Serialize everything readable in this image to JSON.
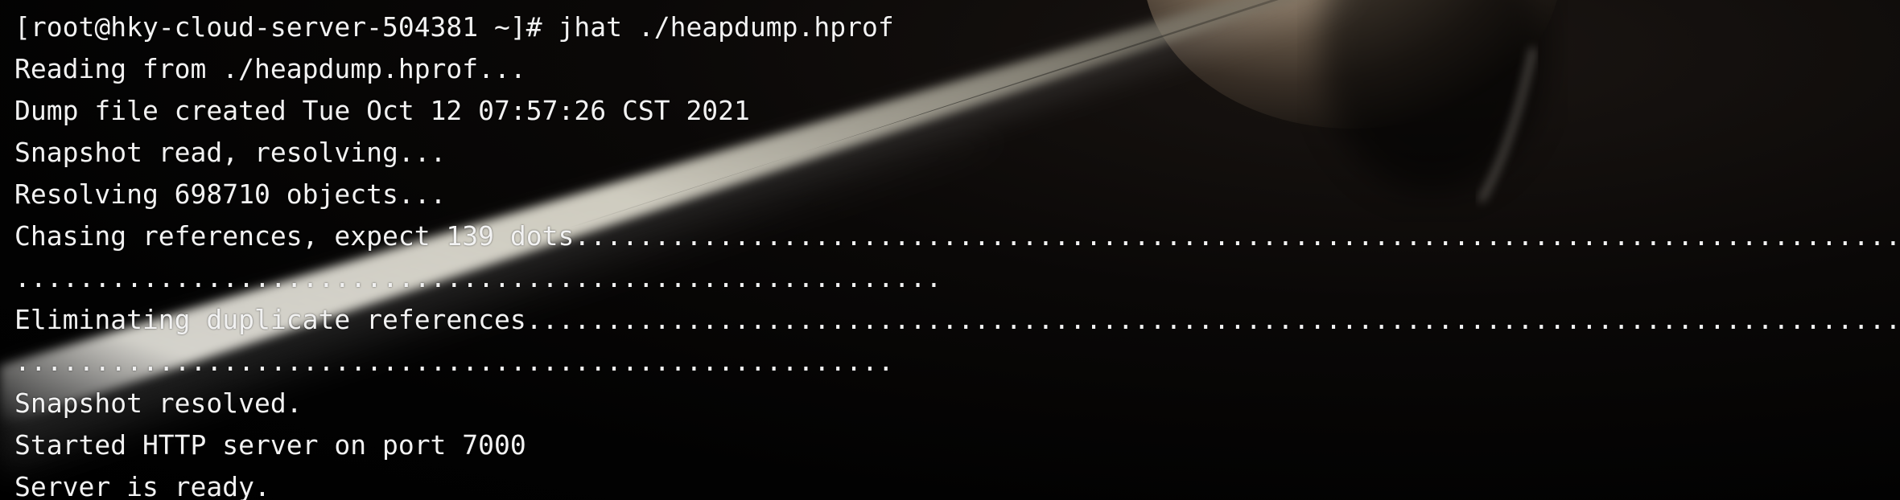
{
  "terminal": {
    "colors": {
      "background": "#000000",
      "foreground": "#f2f2f2"
    },
    "lines": [
      "[root@hky-cloud-server-504381 ~]# jhat ./heapdump.hprof",
      "Reading from ./heapdump.hprof...",
      "Dump file created Tue Oct 12 07:57:26 CST 2021",
      "Snapshot read, resolving...",
      "Resolving 698710 objects...",
      "Chasing references, expect 139 dots.......................................................................................",
      "..........................................................",
      "Eliminating duplicate references..........................................................................................",
      ".......................................................",
      "Snapshot resolved.",
      "Started HTTP server on port 7000",
      "Server is ready."
    ]
  }
}
